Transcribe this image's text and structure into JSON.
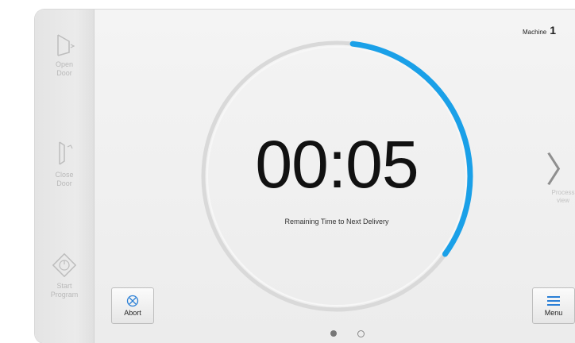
{
  "sidebar": {
    "items": [
      {
        "label": "Open\nDoor",
        "icon": "door-open-icon"
      },
      {
        "label": "Close\nDoor",
        "icon": "door-close-icon"
      },
      {
        "label": "Start\nProgram",
        "icon": "start-program-icon"
      }
    ]
  },
  "header": {
    "machine_label": "Machine",
    "machine_number": "1"
  },
  "timer": {
    "time": "00:05",
    "caption": "Remaining Time to Next Delivery",
    "progress": 0.33,
    "accent_color": "#1aa0e8"
  },
  "nav": {
    "next_label": "Process\nview",
    "next_icon": "chevron-right-icon"
  },
  "actions": {
    "abort_label": "Abort",
    "abort_icon": "abort-icon",
    "menu_label": "Menu",
    "menu_icon": "menu-icon"
  },
  "pager": {
    "current": 1,
    "total": 2
  }
}
